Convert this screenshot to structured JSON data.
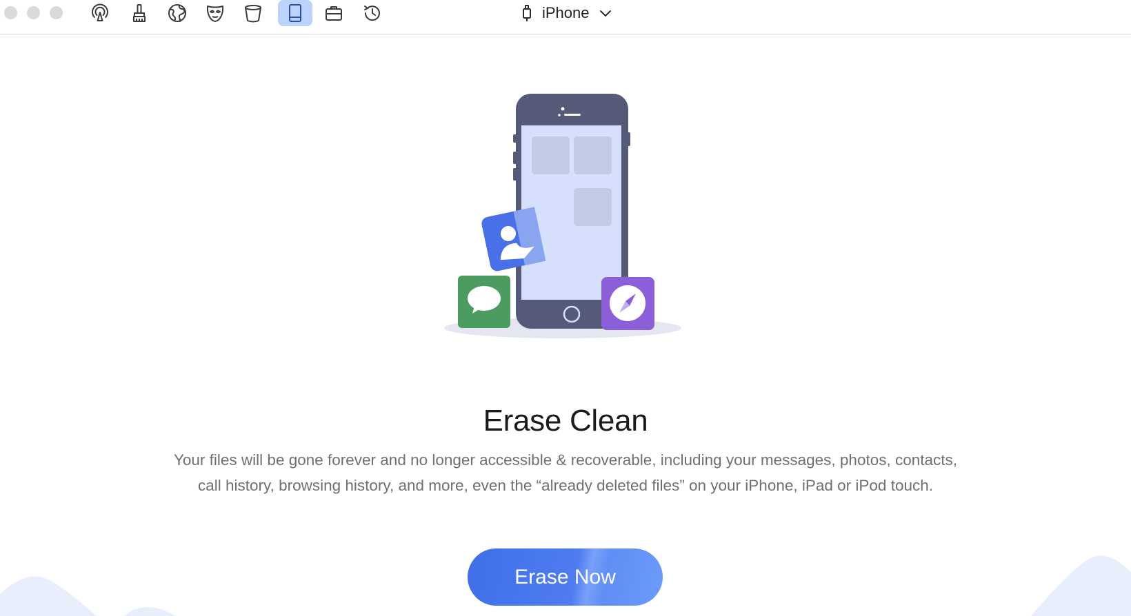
{
  "toolbar": {
    "window_controls": [
      "close",
      "minimize",
      "zoom"
    ],
    "tools": [
      {
        "icon": "airdrop-icon"
      },
      {
        "icon": "cleanup-brush-icon"
      },
      {
        "icon": "internet-globe-icon"
      },
      {
        "icon": "privacy-mask-icon"
      },
      {
        "icon": "trash-bin-icon"
      },
      {
        "icon": "device-tablet-icon",
        "active": true
      },
      {
        "icon": "toolbox-briefcase-icon"
      },
      {
        "icon": "history-clock-icon"
      }
    ],
    "device_name": "iPhone",
    "device_icon": "cable-connector-icon"
  },
  "main": {
    "title": "Erase Clean",
    "description": "Your files will be gone forever and no longer accessible & recoverable, including your messages, photos, contacts, call history, browsing history, and more, even the “already deleted files” on your iPhone, iPad or iPod touch.",
    "erase_button_label": "Erase Now"
  },
  "colors": {
    "accent": "#4a78ee",
    "active_tool_bg": "#bcd3fb",
    "phone_body": "#555a78",
    "phone_screen": "#d6dffb",
    "contacts_tile": "#4a70e8",
    "messages_tile": "#4c9c61",
    "safari_tile": "#8b5fd8"
  }
}
